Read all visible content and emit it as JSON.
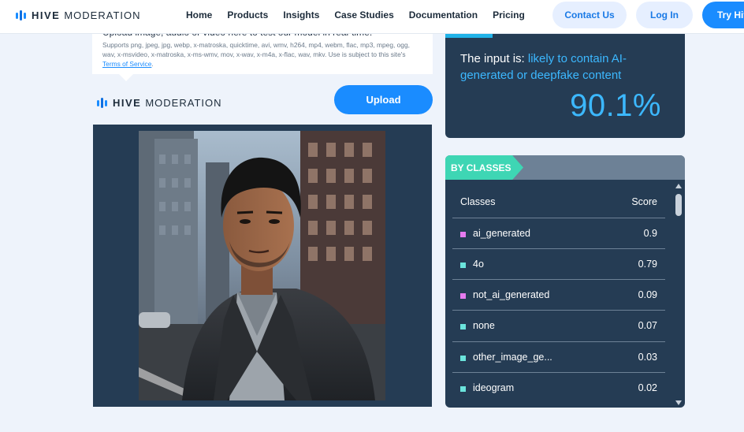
{
  "nav": {
    "brand_bold": "HIVE",
    "brand_light": "MODERATION",
    "links": [
      "Home",
      "Products",
      "Insights",
      "Case Studies",
      "Documentation",
      "Pricing"
    ],
    "contact": "Contact Us",
    "login": "Log In",
    "try": "Try Hive"
  },
  "upload": {
    "title": "Upload image, audio or video here to test our model in real-time.",
    "supports": "Supports png, jpeg, jpg, webp, x-matroska, quicktime, avi, wmv, h264, mp4, webm, flac, mp3, mpeg, ogg, wav, x-msvideo, x-matroska, x-ms-wmv, mov, x-wav, x-m4a, x-flac, wav, mkv. Use is subject to this site's",
    "tos": "Terms of Service",
    "tos_end": ".",
    "button": "Upload"
  },
  "brand_mid": {
    "bold": "HIVE",
    "light": "MODERATION"
  },
  "result": {
    "prefix": "The input is:",
    "verdict": "likely to contain AI-generated or deepfake content",
    "score": "90.1%"
  },
  "classes": {
    "tag": "BY CLASSES",
    "col_classes": "Classes",
    "col_score": "Score",
    "rows": [
      {
        "name": "ai_generated",
        "score": "0.9",
        "color": "#e67bf0"
      },
      {
        "name": "4o",
        "score": "0.79",
        "color": "#6be4dc"
      },
      {
        "name": "not_ai_generated",
        "score": "0.09",
        "color": "#e67bf0"
      },
      {
        "name": "none",
        "score": "0.07",
        "color": "#6be4dc"
      },
      {
        "name": "other_image_ge...",
        "score": "0.03",
        "color": "#6be4dc"
      },
      {
        "name": "ideogram",
        "score": "0.02",
        "color": "#6be4dc"
      }
    ]
  },
  "colors": {
    "accent": "#1a8cff",
    "panel": "#253c54",
    "highlight": "#3cb8ff",
    "tag": "#3ed6b4"
  }
}
